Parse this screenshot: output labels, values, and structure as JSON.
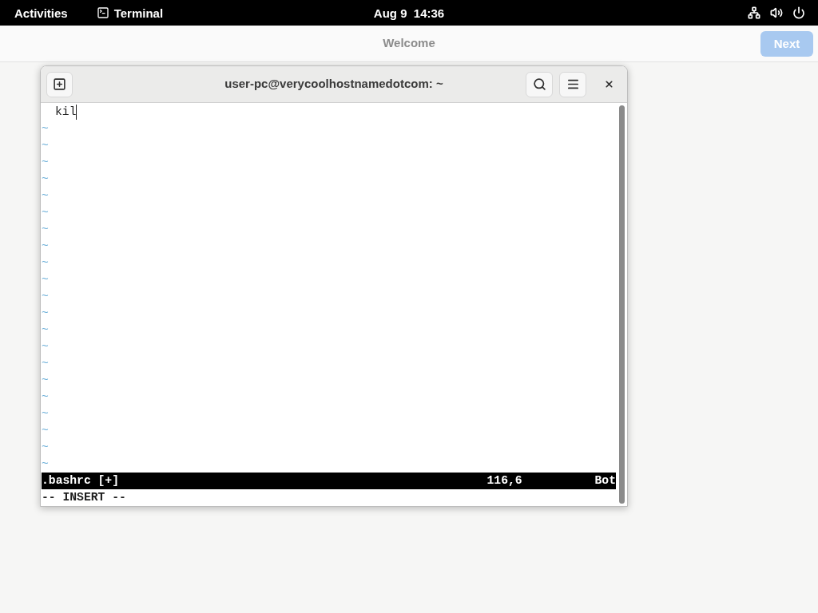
{
  "top_bar": {
    "activities": "Activities",
    "app_menu": {
      "label": "Terminal"
    },
    "clock": "Aug 9  14:36"
  },
  "welcome_window": {
    "title": "Welcome",
    "next_button": {
      "label": "Next",
      "disabled": true
    }
  },
  "terminal": {
    "title": "user-pc@verycoolhostnamedotcom: ~",
    "lines": [
      {
        "text": "kil",
        "cursor": true
      }
    ],
    "empty_lines": [
      "~",
      "~",
      "~",
      "~",
      "~",
      "~",
      "~",
      "~",
      "~",
      "~",
      "~",
      "~",
      "~",
      "~",
      "~",
      "~",
      "~",
      "~",
      "~",
      "~",
      "~"
    ],
    "status_line": {
      "file": ".bashrc [+]",
      "ruler": "116,6",
      "position": "Bot"
    },
    "mode": "-- INSERT --"
  }
}
